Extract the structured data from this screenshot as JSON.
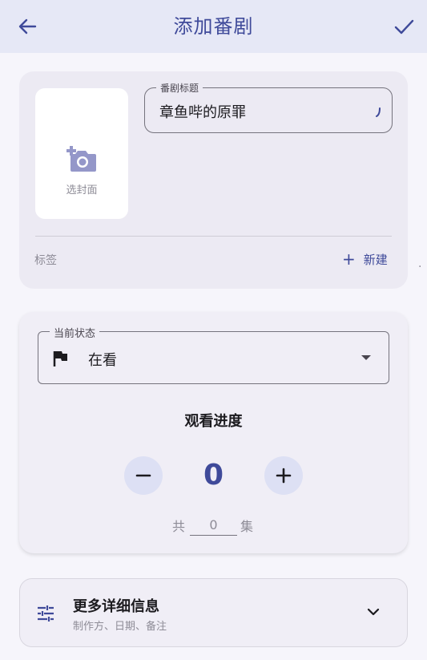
{
  "header": {
    "title": "添加番剧",
    "back_icon": "arrow-left-icon",
    "confirm_icon": "check-icon",
    "accent_color": "#3f4a9a"
  },
  "cover": {
    "icon": "add-photo-icon",
    "label": "选封面"
  },
  "title_field": {
    "label": "番剧标题",
    "value": "章鱼哔的原罪"
  },
  "tags": {
    "label": "标签",
    "new_button": "新建",
    "new_icon": "plus-icon"
  },
  "status": {
    "label": "当前状态",
    "value": "在看",
    "icon": "flag-icon",
    "dropdown_icon": "caret-down-icon"
  },
  "progress": {
    "title": "观看进度",
    "value": "0",
    "total_prefix": "共",
    "total_value": "0",
    "total_suffix": "集"
  },
  "more": {
    "title": "更多详细信息",
    "subtitle": "制作方、日期、备注",
    "icon": "tune-icon",
    "expand_icon": "chevron-down-icon"
  }
}
